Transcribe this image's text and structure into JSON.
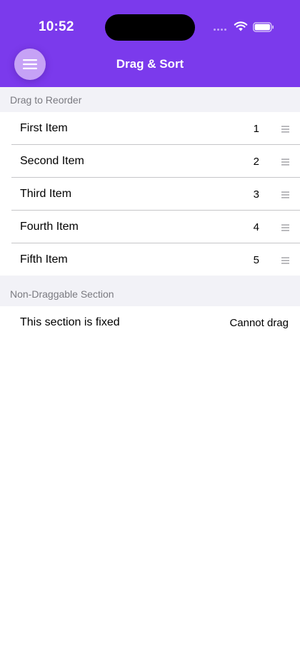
{
  "status_bar": {
    "time": "10:52"
  },
  "header": {
    "title": "Drag & Sort",
    "menu_icon": "hamburger-icon",
    "background": "#7B3AEC"
  },
  "sections": [
    {
      "title": "Drag to Reorder",
      "items": [
        {
          "label": "First Item",
          "number": "1"
        },
        {
          "label": "Second Item",
          "number": "2"
        },
        {
          "label": "Third Item",
          "number": "3"
        },
        {
          "label": "Fourth Item",
          "number": "4"
        },
        {
          "label": "Fifth Item",
          "number": "5"
        }
      ],
      "handle_icon": "drag-handle-icon"
    },
    {
      "title": "Non-Draggable Section",
      "fixed_item": {
        "label": "This section is fixed",
        "detail": "Cannot drag"
      }
    }
  ]
}
